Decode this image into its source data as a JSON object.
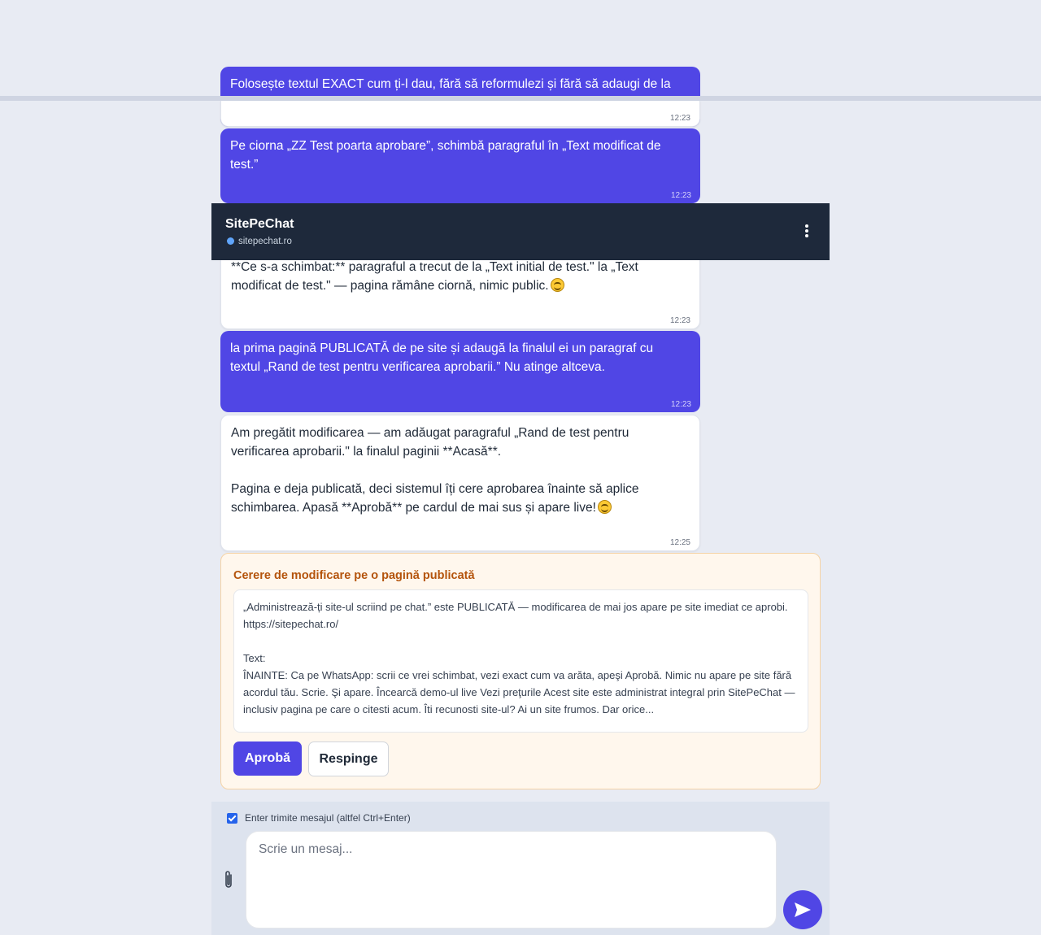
{
  "header": {
    "app_name": "SitePeChat",
    "domain": "sitepechat.ro"
  },
  "messages": [
    {
      "role": "user",
      "text": "Folosește textul EXACT cum ți-l dau, fără să reformulezi și fără să adaugi de la",
      "time": "12:23"
    },
    {
      "role": "user",
      "text": "Pe ciorna „ZZ Test poarta aprobare”, schimbă paragraful în „Text modificat de test.”",
      "time": "12:23"
    },
    {
      "role": "bot",
      "text": "**Ce s-a schimbat:** paragraful a trecut de la „Text initial de test.\" la „Text modificat de test.\" — pagina rămâne ciornă, nimic public.",
      "time": "12:23"
    },
    {
      "role": "user",
      "text": "la prima pagină PUBLICATĂ de pe site și adaugă la finalul ei un paragraf cu textul „Rand de test pentru verificarea aprobarii.” Nu atinge altceva.",
      "time": "12:23"
    },
    {
      "role": "bot",
      "text": "Am pregătit modificarea — am adăugat paragraful „Rand de test pentru verificarea aprobarii.\" la finalul paginii **Acasă**.\n\nPagina e deja publicată, deci sistemul îți cere aprobarea înainte să aplice schimbarea. Apasă **Aprobă** pe cardul de mai sus și apare live!",
      "time": "12:25"
    }
  ],
  "approval": {
    "title": "Cerere de modificare pe o pagină publicată",
    "body": "„Administrează-ți site-ul scriind pe chat.” este PUBLICATĂ — modificarea de mai jos apare pe site imediat ce aprobi.\nhttps://sitepechat.ro/\n\nText:\nÎNAINTE: Ca pe WhatsApp: scrii ce vrei schimbat, vezi exact cum va arăta, apeşi Aprobă. Nimic nu apare pe site fără acordul tău. Scrie. Şi apare. Încearcă demo-ul live Vezi preţurile Acest site este administrat integral prin SitePeChat — inclusiv pagina pe care o citesti acum. Îti recunosti site-ul? Ai un site frumos. Dar orice...",
    "approve_label": "Aprobă",
    "reject_label": "Respinge"
  },
  "composer": {
    "enter_label": "Enter trimite mesajul (altfel Ctrl+Enter)",
    "enter_checked": true,
    "placeholder": "Scrie un mesaj..."
  },
  "icons": {
    "menu": "kebab-menu-icon",
    "attach": "paperclip-icon",
    "send": "send-icon",
    "emoji": "smiling-face-icon"
  },
  "colors": {
    "user_bubble": "#5046e5",
    "header_bg": "#1e293b",
    "approval_bg": "#fff7ed",
    "approval_title": "#b4540c"
  }
}
